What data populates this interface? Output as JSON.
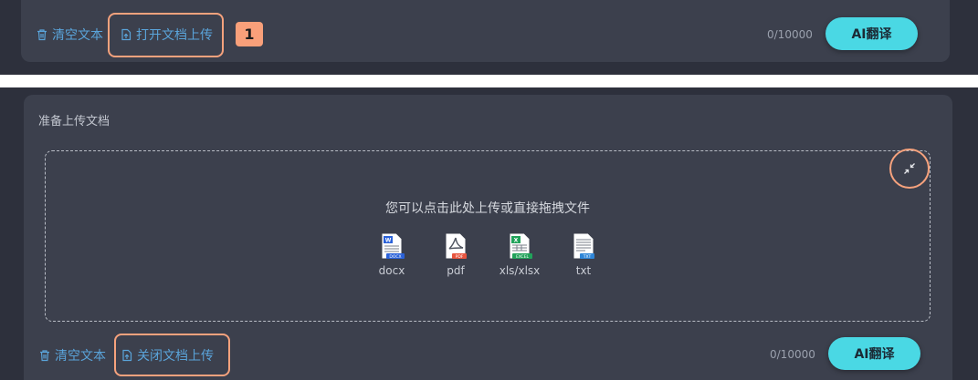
{
  "top_panel": {
    "clear_text_label": "清空文本",
    "open_upload_label": "打开文档上传",
    "step_badge": "1",
    "char_counter": "0/10000",
    "translate_button": "AI翻译"
  },
  "bottom_panel": {
    "section_title": "准备上传文档",
    "dropzone_text": "您可以点击此处上传或直接拖拽文件",
    "file_types": [
      {
        "label": "docx",
        "tag": "DOCX",
        "icon": "word-file-icon",
        "color": "#2b62d9"
      },
      {
        "label": "pdf",
        "tag": "PDF",
        "icon": "pdf-file-icon",
        "color": "#e8553f"
      },
      {
        "label": "xls/xlsx",
        "tag": "EXCEL",
        "icon": "excel-file-icon",
        "color": "#21a25a"
      },
      {
        "label": "txt",
        "tag": "TXT",
        "icon": "txt-file-icon",
        "color": "#2f86d8"
      }
    ],
    "clear_text_label": "清空文本",
    "close_upload_label": "关闭文档上传",
    "char_counter": "0/10000",
    "translate_button": "AI翻译"
  },
  "colors": {
    "link": "#5aa4da",
    "highlight": "#f6a27d",
    "accent_button": "#4ad8e4"
  }
}
